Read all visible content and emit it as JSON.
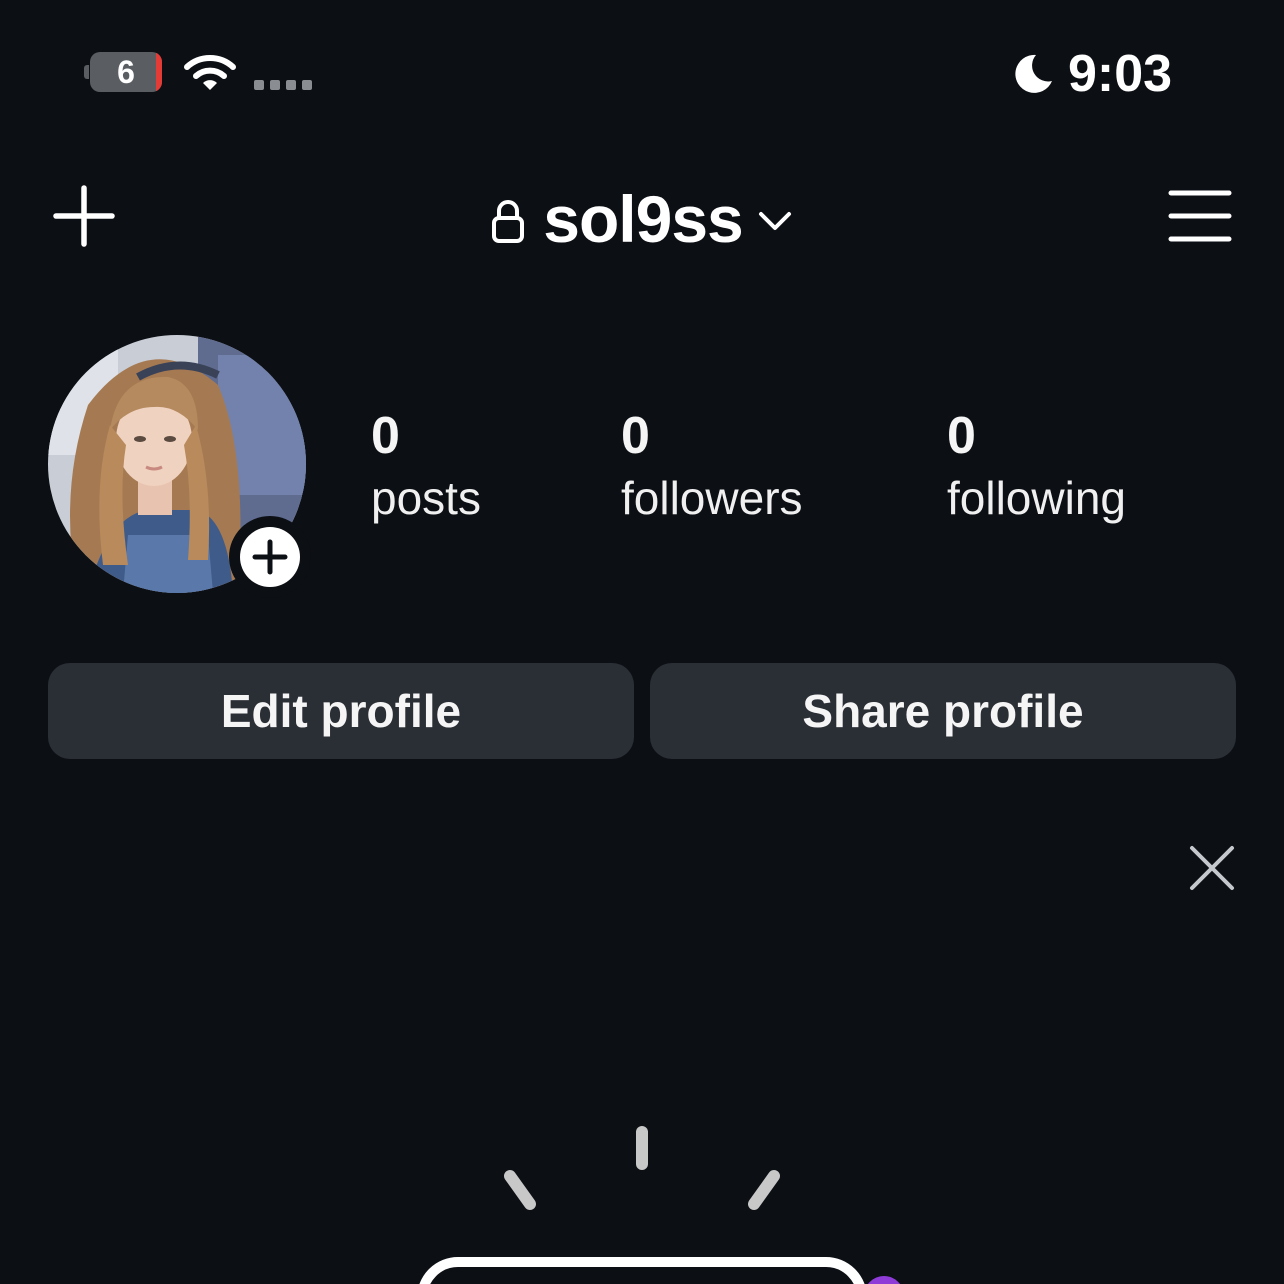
{
  "status_bar": {
    "battery_level": "6",
    "time": "9:03",
    "icons": [
      "battery-icon",
      "wifi-icon",
      "signal-icon",
      "moon-icon"
    ]
  },
  "header": {
    "username": "sol9ss",
    "icons": [
      "plus-icon",
      "lock-icon",
      "chevron-down-icon",
      "hamburger-menu-icon"
    ]
  },
  "profile": {
    "stats": [
      {
        "value": "0",
        "label": "posts"
      },
      {
        "value": "0",
        "label": "followers"
      },
      {
        "value": "0",
        "label": "following"
      }
    ]
  },
  "actions": {
    "edit_label": "Edit profile",
    "share_label": "Share profile"
  },
  "colors": {
    "background": "#0c0f14",
    "button_bg": "#2a2e35",
    "text": "#f5f5f5",
    "battery_low": "#e43b36"
  }
}
